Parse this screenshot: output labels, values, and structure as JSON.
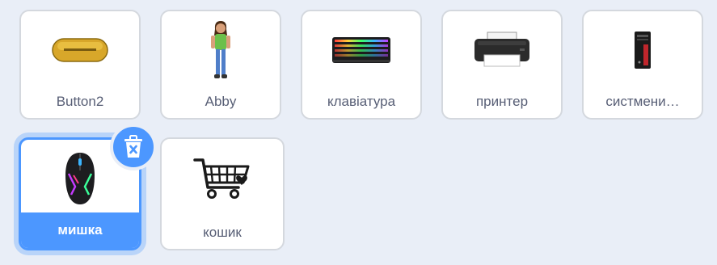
{
  "sprites": [
    {
      "name": "Button2",
      "icon": "button-sprite-icon"
    },
    {
      "name": "Abby",
      "icon": "abby-sprite-icon"
    },
    {
      "name": "клавіатура",
      "icon": "keyboard-icon"
    },
    {
      "name": "принтер",
      "icon": "printer-icon"
    },
    {
      "name": "систмени…",
      "icon": "computer-tower-icon"
    },
    {
      "name": "мишка",
      "icon": "mouse-icon",
      "selected": true
    },
    {
      "name": "кошик",
      "icon": "shopping-cart-icon"
    }
  ],
  "colors": {
    "selection_blue": "#4c97ff",
    "label_gray": "#575e75",
    "pane_background": "#e9eef7"
  }
}
